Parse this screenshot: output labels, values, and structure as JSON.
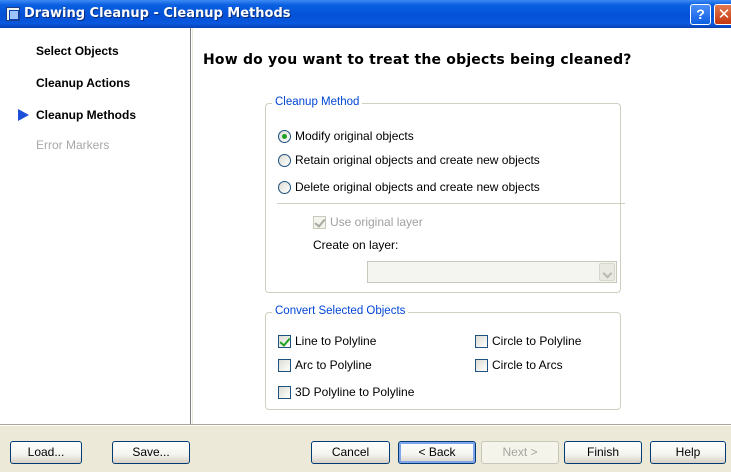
{
  "window": {
    "title": "Drawing Cleanup - Cleanup Methods",
    "help_glyph": "?",
    "close_glyph": "✕"
  },
  "nav": {
    "items": [
      {
        "label": "Select Objects",
        "state": "done"
      },
      {
        "label": "Cleanup Actions",
        "state": "done"
      },
      {
        "label": "Cleanup Methods",
        "state": "current"
      },
      {
        "label": "Error Markers",
        "state": "disabled"
      }
    ]
  },
  "main": {
    "heading": "How do you want to treat the objects being cleaned?",
    "cleanup_method": {
      "legend": "Cleanup Method",
      "options": [
        {
          "label": "Modify original objects",
          "checked": true
        },
        {
          "label": "Retain original objects and create new objects",
          "checked": false
        },
        {
          "label": "Delete original objects and create new objects",
          "checked": false
        }
      ],
      "use_original_layer": {
        "label": "Use original layer",
        "checked": true,
        "enabled": false
      },
      "create_on_layer_label": "Create on layer:",
      "create_on_layer_value": ""
    },
    "convert": {
      "legend": "Convert Selected Objects",
      "options": [
        {
          "label": "Line to Polyline",
          "checked": true
        },
        {
          "label": "Arc to Polyline",
          "checked": false
        },
        {
          "label": "3D Polyline to Polyline",
          "checked": false
        },
        {
          "label": "Circle to Polyline",
          "checked": false
        },
        {
          "label": "Circle to Arcs",
          "checked": false
        }
      ]
    }
  },
  "buttons": {
    "load": "Load...",
    "save": "Save...",
    "cancel": "Cancel",
    "back": "< Back",
    "next": "Next >",
    "finish": "Finish",
    "help": "Help"
  },
  "colors": {
    "titlebar": "#0451d8",
    "legend_text": "#0046d5",
    "current_arrow": "#1e4fd8",
    "check_mark": "#21a121"
  }
}
